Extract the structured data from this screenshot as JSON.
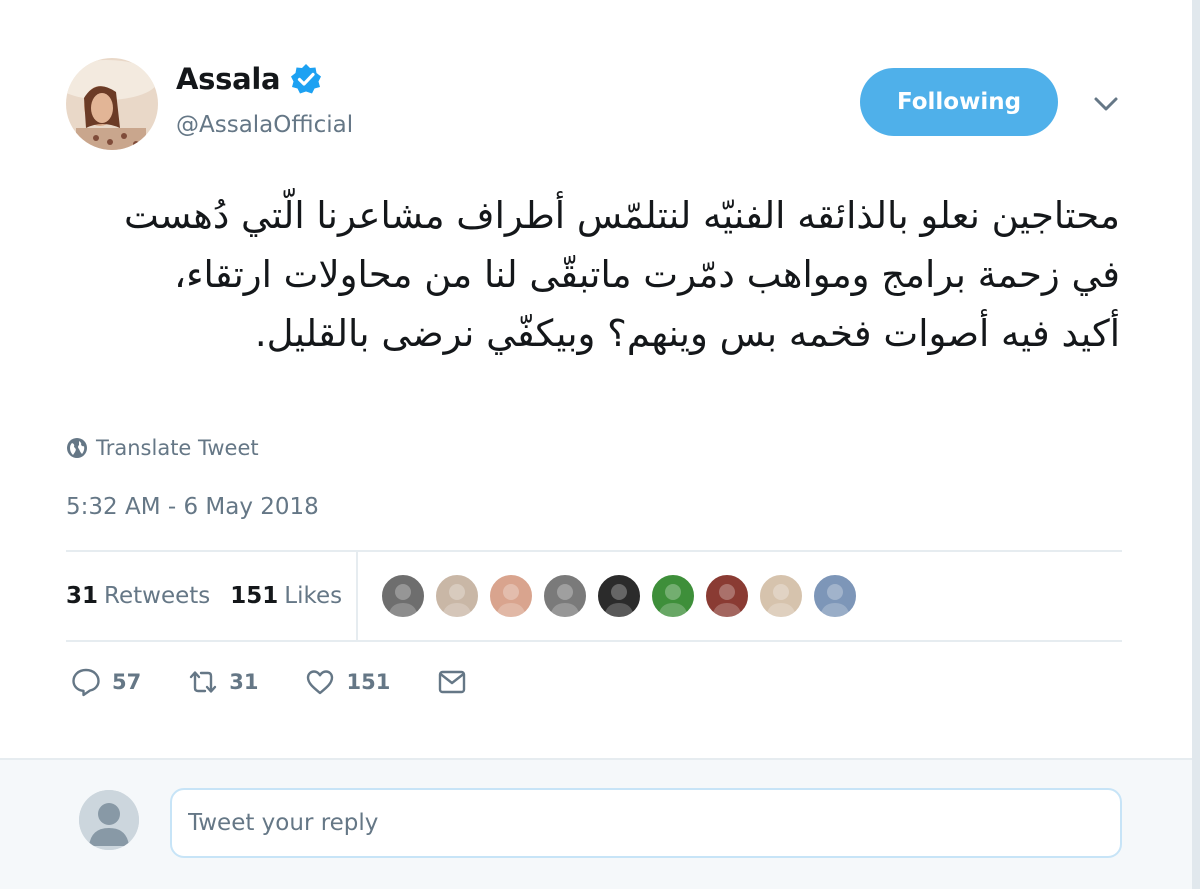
{
  "author": {
    "name": "Assala",
    "handle": "@AssalaOfficial",
    "verified": true
  },
  "follow_button": {
    "label": "Following"
  },
  "menu": {
    "icon": "chevron-down-icon"
  },
  "tweet": {
    "text": "محتاجين نعلو بالذائقه الفنيّه لنتلمّس أطراف مشاعرنا الّتي دُهست في زحمة برامج ومواهب دمّرت ماتبقّى لنا من محاولات ارتقاء، أكيد فيه أصوات فخمه بس وينهم؟ وبيكفّي نرضى بالقليل.",
    "translate_label": "Translate Tweet",
    "timestamp": "5:32 AM - 6 May 2018"
  },
  "stats": {
    "retweets_count": "31",
    "retweets_label": "Retweets",
    "likes_count": "151",
    "likes_label": "Likes"
  },
  "likers": [
    {
      "color": "#6e6e6e"
    },
    {
      "color": "#c9b7a6"
    },
    {
      "color": "#d9a48e"
    },
    {
      "color": "#7a7a7a"
    },
    {
      "color": "#2b2b2b"
    },
    {
      "color": "#3e8f3a"
    },
    {
      "color": "#8a3b33"
    },
    {
      "color": "#d6c3ad"
    },
    {
      "color": "#7d96b8"
    }
  ],
  "actions": {
    "reply_count": "57",
    "retweet_count": "31",
    "like_count": "151"
  },
  "reply": {
    "placeholder": "Tweet your reply"
  },
  "colors": {
    "accent": "#4fb0ea",
    "verified": "#1da1f2",
    "secondary_text": "#657786"
  }
}
